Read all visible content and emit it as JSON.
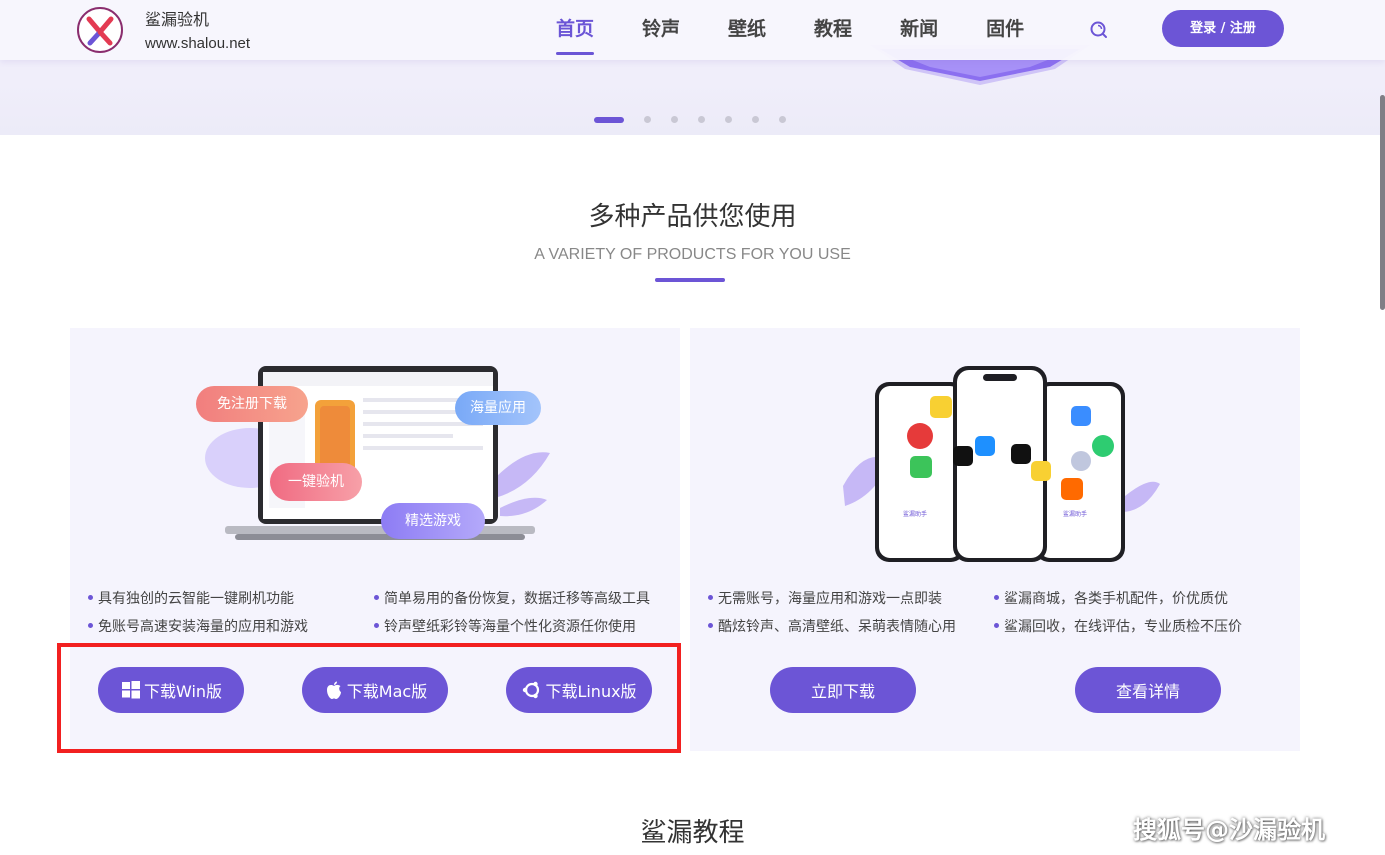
{
  "header": {
    "brand_name": "鲨漏验机",
    "brand_url": "www.shalou.net",
    "nav": [
      {
        "label": "首页",
        "active": true
      },
      {
        "label": "铃声",
        "active": false
      },
      {
        "label": "壁纸",
        "active": false
      },
      {
        "label": "教程",
        "active": false
      },
      {
        "label": "新闻",
        "active": false
      },
      {
        "label": "固件",
        "active": false
      }
    ],
    "search_icon": "search-icon",
    "login_label": "登录 / 注册"
  },
  "hero": {
    "carousel_total": 7,
    "carousel_active": 1
  },
  "products": {
    "title": "多种产品供您使用",
    "subtitle": "A VARIETY OF PRODUCTS FOR YOU USE",
    "pc_card": {
      "tags": [
        "免注册下载",
        "海量应用",
        "一键验机",
        "精选游戏"
      ],
      "features": [
        "具有独创的云智能一键刷机功能",
        "简单易用的备份恢复，数据迁移等高级工具",
        "免账号高速安装海量的应用和游戏",
        "铃声壁纸彩铃等海量个性化资源任你使用"
      ],
      "buttons": [
        {
          "label": "下载Win版",
          "icon": "windows-icon"
        },
        {
          "label": "下载Mac版",
          "icon": "apple-icon"
        },
        {
          "label": "下载Linux版",
          "icon": "linux-icon"
        }
      ]
    },
    "mobile_card": {
      "features": [
        "无需账号，海量应用和游戏一点即装",
        "鲨漏商城，各类手机配件，价优质优",
        "酷炫铃声、高清壁纸、呆萌表情随心用",
        "鲨漏回收，在线评估，专业质检不压价"
      ],
      "buttons": [
        {
          "label": "立即下载"
        },
        {
          "label": "查看详情"
        }
      ]
    }
  },
  "next_section_title": "鲨漏教程",
  "watermark": "搜狐号@沙漏验机",
  "colors": {
    "accent": "#6c55d6",
    "highlight_box": "#f22020"
  }
}
